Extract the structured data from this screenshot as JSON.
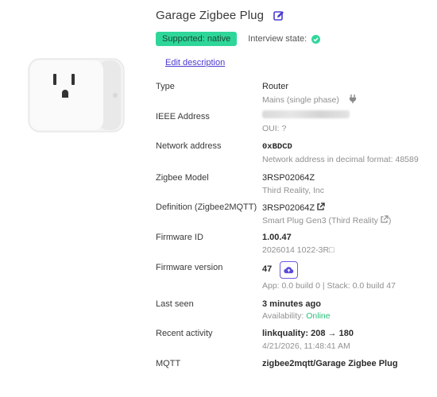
{
  "device": {
    "title": "Garage Zigbee Plug",
    "badge": "Supported: native",
    "interview_label": "Interview state:",
    "edit_description": "Edit description"
  },
  "fields": {
    "type": {
      "label": "Type",
      "value": "Router",
      "sub": "Mains (single phase)"
    },
    "ieee": {
      "label": "IEEE Address",
      "sub": "OUI: ?"
    },
    "network": {
      "label": "Network address",
      "value": "0xBDCD",
      "sub": "Network address in decimal format: 48589"
    },
    "model": {
      "label": "Zigbee Model",
      "value": "3RSP02064Z",
      "sub": "Third Reality, Inc"
    },
    "definition": {
      "label": "Definition (Zigbee2MQTT)",
      "value": "3RSP02064Z",
      "sub": "Smart Plug Gen3 (Third Reality",
      "sub_close": ")"
    },
    "firmware_id": {
      "label": "Firmware ID",
      "value": "1.00.47",
      "sub": "2026014 1022-3R□"
    },
    "firmware_version": {
      "label": "Firmware version",
      "value": "47",
      "sub": "App: 0.0 build 0 | Stack: 0.0 build 47"
    },
    "last_seen": {
      "label": "Last seen",
      "value": "3 minutes ago",
      "sub_prefix": "Availability: ",
      "sub_status": "Online"
    },
    "activity": {
      "label": "Recent activity",
      "value": "linkquality: 208 → 180",
      "sub": "4/21/2026, 11:48:41 AM"
    },
    "mqtt": {
      "label": "MQTT",
      "value": "zigbee2mqtt/Garage Zigbee Plug"
    }
  },
  "colors": {
    "accent": "#4b3bd1",
    "badge_bg": "#2fd69a",
    "online": "#27c07a"
  },
  "icons": {
    "edit": "edit-icon",
    "check": "check-circle-icon",
    "plug": "plug-icon",
    "external_link": "external-link-icon",
    "cloud": "cloud-upload-icon"
  }
}
